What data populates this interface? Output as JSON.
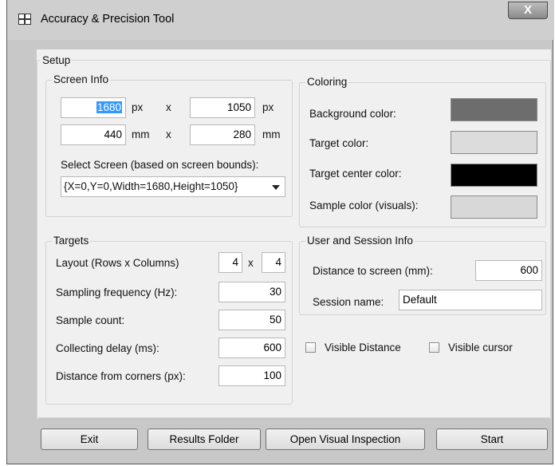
{
  "window": {
    "title": "Accuracy & Precision Tool",
    "close_label": "X"
  },
  "setup": {
    "title": "Setup",
    "screen_info": {
      "title": "Screen Info",
      "width_px": "1680",
      "height_px": "1050",
      "px_unit": "px",
      "width_mm": "440",
      "height_mm": "280",
      "mm_unit": "mm",
      "times": "x",
      "select_label": "Select Screen (based on screen bounds):",
      "select_value": "{X=0,Y=0,Width=1680,Height=1050}"
    },
    "coloring": {
      "title": "Coloring",
      "items": [
        {
          "label": "Background color:",
          "color": "#6d6d6d"
        },
        {
          "label": "Target color:",
          "color": "#dcdcdc"
        },
        {
          "label": "Target center color:",
          "color": "#000000"
        },
        {
          "label": "Sample color (visuals):",
          "color": "#d8d8d8"
        }
      ]
    },
    "targets": {
      "title": "Targets",
      "layout_label": "Layout (Rows x Columns)",
      "rows": "4",
      "cols": "4",
      "times": "x",
      "sampling_label": "Sampling frequency (Hz):",
      "sampling_value": "30",
      "count_label": "Sample count:",
      "count_value": "50",
      "delay_label": "Collecting delay (ms):",
      "delay_value": "600",
      "corners_label": "Distance from corners (px):",
      "corners_value": "100"
    },
    "user_session": {
      "title": "User and Session Info",
      "distance_label": "Distance to screen (mm):",
      "distance_value": "600",
      "session_label": "Session name:",
      "session_value": "Default"
    },
    "visible_distance_label": "Visible Distance",
    "visible_cursor_label": "Visible cursor"
  },
  "buttons": {
    "exit": "Exit",
    "results_folder": "Results Folder",
    "open_visual": "Open Visual Inspection",
    "start": "Start"
  }
}
